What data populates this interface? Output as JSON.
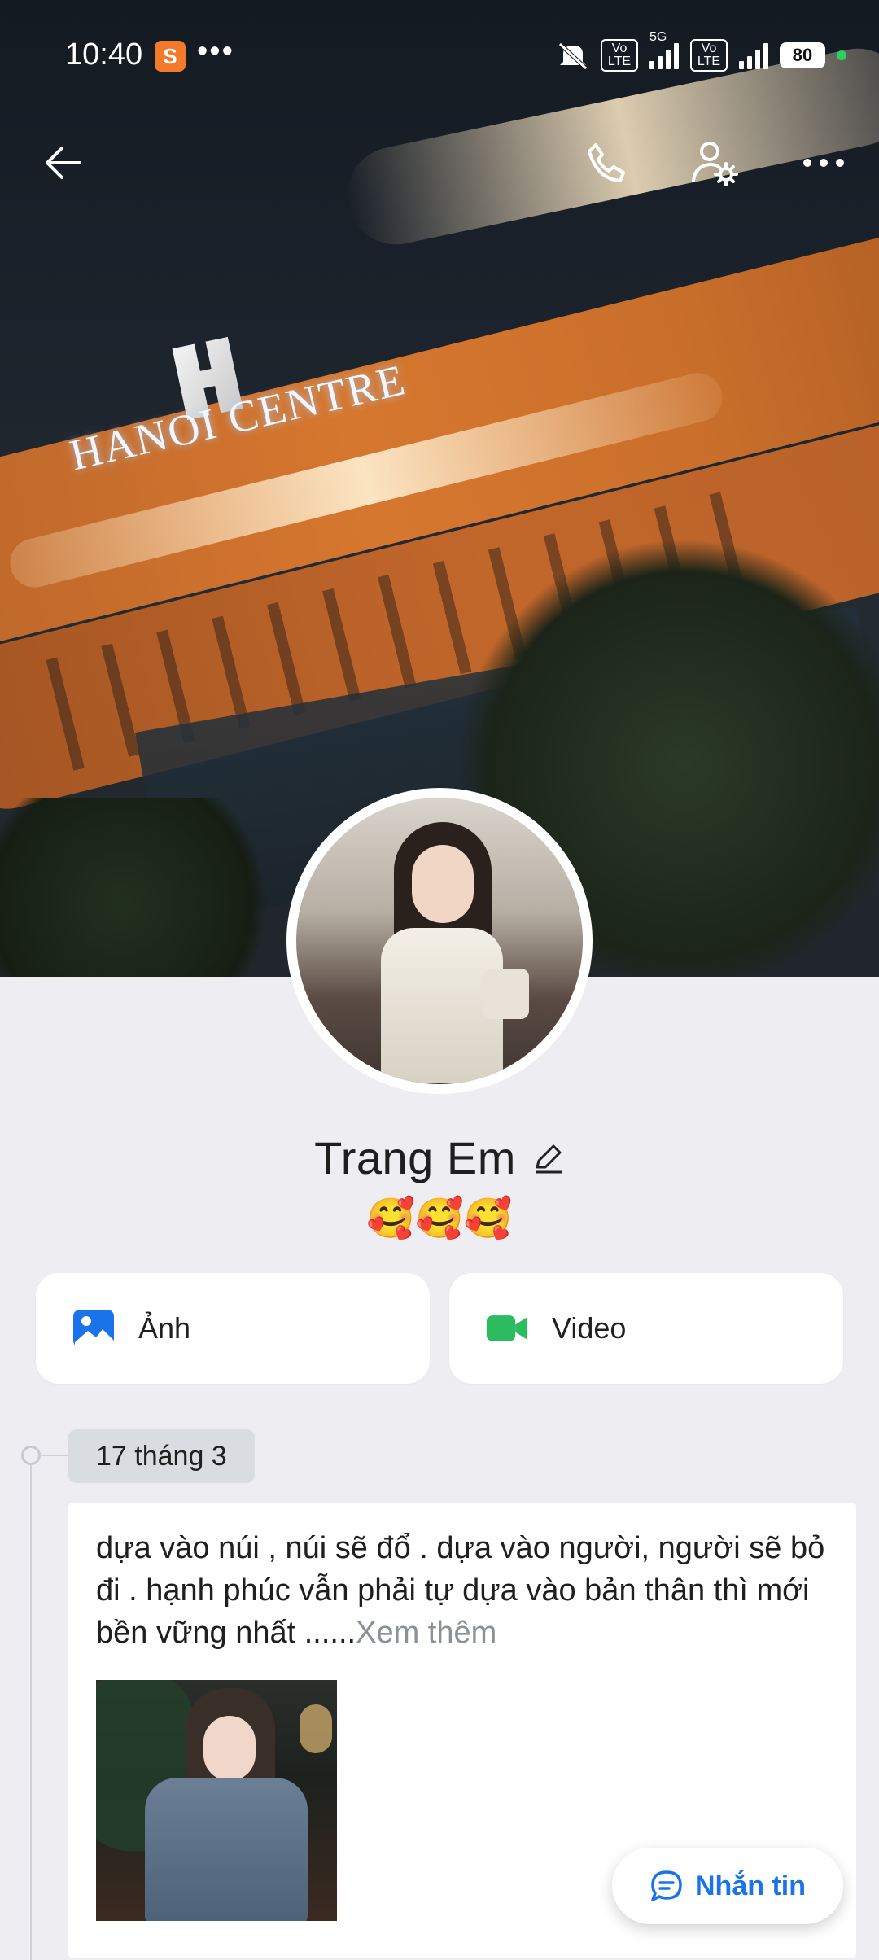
{
  "status_bar": {
    "time": "10:40",
    "app_badge_icon": "shopee-app-icon",
    "overflow_dots": "•••",
    "network_5g": "5G",
    "volte_label_1": "Vo LTE",
    "volte_label_2": "Vo LTE",
    "battery": "80",
    "colors": {
      "text": "#ffffff",
      "battery_dot": "#2bd15b"
    }
  },
  "cover": {
    "sign_text": "HANOI CENTRE"
  },
  "top_nav": {
    "back_icon": "back-arrow-icon",
    "call_icon": "phone-icon",
    "settings_icon": "user-settings-icon",
    "more_icon": "more-icon"
  },
  "profile": {
    "name": "Trang Em",
    "edit_icon": "pencil-icon",
    "status": "🥰🥰🥰"
  },
  "actions": [
    {
      "label": "Ảnh",
      "icon": "photo-icon",
      "color": "#1a73e8"
    },
    {
      "label": "Video",
      "icon": "video-camera-icon",
      "color": "#2dbb5f"
    }
  ],
  "timeline": {
    "date": "17 tháng 3",
    "post": {
      "text": "dựa vào núi , núi sẽ đổ . dựa vào người, người sẽ bỏ đi . hạnh phúc vẫn phải tự dựa vào bản thân thì mới bền vững nhất ......",
      "see_more": "Xem thêm"
    }
  },
  "floating_button": {
    "label": "Nhắn tin",
    "icon": "chat-bubble-icon",
    "color": "#1a73e8"
  }
}
